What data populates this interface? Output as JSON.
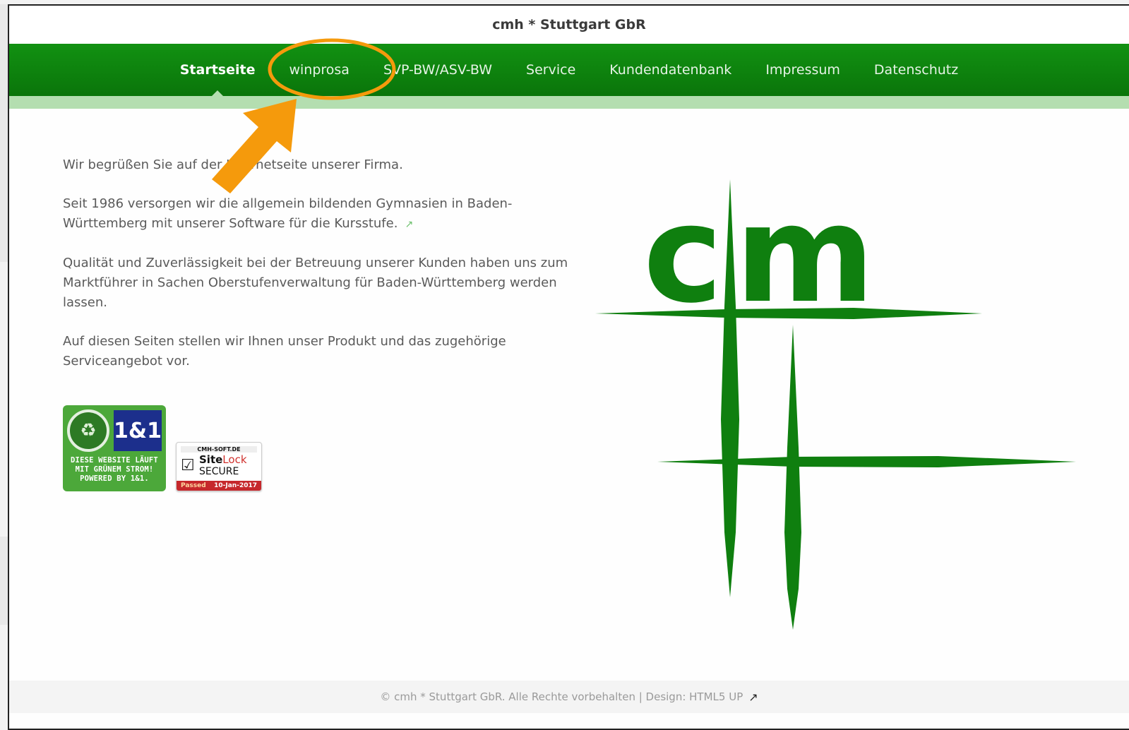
{
  "site_title": "cmh * Stuttgart GbR",
  "nav": {
    "items": [
      {
        "label": "Startseite",
        "active": true
      },
      {
        "label": "winprosa",
        "active": false
      },
      {
        "label": "SVP-BW/ASV-BW",
        "active": false
      },
      {
        "label": "Service",
        "active": false
      },
      {
        "label": "Kundendatenbank",
        "active": false
      },
      {
        "label": "Impressum",
        "active": false
      },
      {
        "label": "Datenschutz",
        "active": false
      }
    ]
  },
  "content": {
    "p1": "Wir begrüßen Sie auf der Internetseite unserer Firma.",
    "p2": "Seit 1986 versorgen wir die allgemein bildenden Gymnasien in Baden-Württemberg mit unserer Software für die Kursstufe.",
    "p3": "Qualität und Zuverlässigkeit bei der Betreuung unserer Kunden haben uns zum Marktführer in Sachen Oberstufenverwaltung für Baden-Württemberg werden lassen.",
    "p4": "Auf diesen Seiten stellen wir Ihnen unser Produkt und das zugehörige Serviceangebot vor."
  },
  "badges": {
    "green": {
      "brand": "1&1",
      "text": "DIESE WEBSITE LÄUFT MIT GRÜNEM STROM! POWERED BY 1&1."
    },
    "sitelock": {
      "domain": "CMH-SOFT.DE",
      "site": "Site",
      "lock": "Lock",
      "secure": "SECURE",
      "passed": "Passed",
      "date": "10-Jan-2017"
    }
  },
  "logo": {
    "letters": "cm",
    "color": "#0f7f0f"
  },
  "footer": {
    "text": "© cmh * Stuttgart GbR. Alle Rechte vorbehalten | Design: HTML5 UP"
  },
  "annotation": {
    "color": "#f59a0c",
    "target": "winprosa"
  },
  "icons": {
    "external_link": "external-link-icon"
  }
}
